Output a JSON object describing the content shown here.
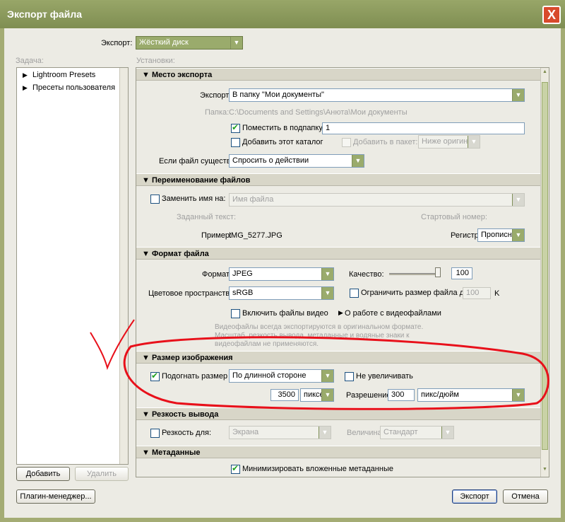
{
  "window": {
    "title": "Экспорт файла",
    "close": "X"
  },
  "export_to": {
    "label": "Экспорт:",
    "value": "Жёсткий диск"
  },
  "task": {
    "label": "Задача:",
    "items": [
      "Lightroom Presets",
      "Пресеты пользователя"
    ],
    "add": "Добавить",
    "remove": "Удалить"
  },
  "settings_label": "Установки:",
  "location": {
    "title": "Место экспорта",
    "export_label": "Экспорт:",
    "export_value": "В папку \"Мои документы\"",
    "folder_label": "Папка:",
    "folder_value": "C:\\Documents and Settings\\Анюта\\Мои документы",
    "subfolder_label": "Поместить в подпапку:",
    "subfolder_value": "1",
    "catalog_label": "Добавить этот каталог",
    "stack_label": "Добавить в пакет:",
    "stack_value": "Ниже оригинала",
    "exists_label": "Если файл существует:",
    "exists_value": "Спросить о действии"
  },
  "rename": {
    "title": "Переименование файлов",
    "rename_label": "Заменить имя на:",
    "rename_value": "Имя файла",
    "custom_label": "Заданный текст:",
    "start_label": "Стартовый номер:",
    "example_label": "Пример:",
    "example_value": "IMG_5277.JPG",
    "case_label": "Регистр:",
    "case_value": "Прописные"
  },
  "format": {
    "title": "Формат файла",
    "format_label": "Формат:",
    "format_value": "JPEG",
    "quality_label": "Качество:",
    "quality_value": "100",
    "quality_level": 1.0,
    "colorspace_label": "Цветовое пространство:",
    "colorspace_value": "sRGB",
    "limit_label": "Ограничить размер файла до:",
    "limit_value": "100",
    "limit_unit": "K",
    "video_label": "Включить файлы видео",
    "video_info": "О работе с видеофайлами",
    "note1": "Видеофайлы всегда экспортируются в оригинальном формате.",
    "note2": "Масштаб, резкость вывода, метаданные и водяные знаки к",
    "note3": "видеофайлам не применяются."
  },
  "size": {
    "title": "Размер изображения",
    "fit_label": "Подогнать размер",
    "fit_value": "По длинной стороне",
    "noenlarge_label": "Не увеличивать",
    "dim_value": "3500",
    "dim_unit": "пиксел",
    "res_label": "Разрешение:",
    "res_value": "300",
    "res_unit": "пикс/дюйм"
  },
  "sharpen": {
    "title": "Резкость вывода",
    "label": "Резкость для:",
    "value": "Экрана",
    "amount_label": "Величина:",
    "amount_value": "Стандарт"
  },
  "metadata": {
    "title": "Метаданные",
    "minimize_label": "Минимизировать вложенные метаданные"
  },
  "footer": {
    "plugin": "Плагин-менеджер...",
    "export": "Экспорт",
    "cancel": "Отмена"
  },
  "colors": {
    "annotation": "#e8101a",
    "checkmark": "#21a121",
    "accent": "#9aab6c"
  }
}
